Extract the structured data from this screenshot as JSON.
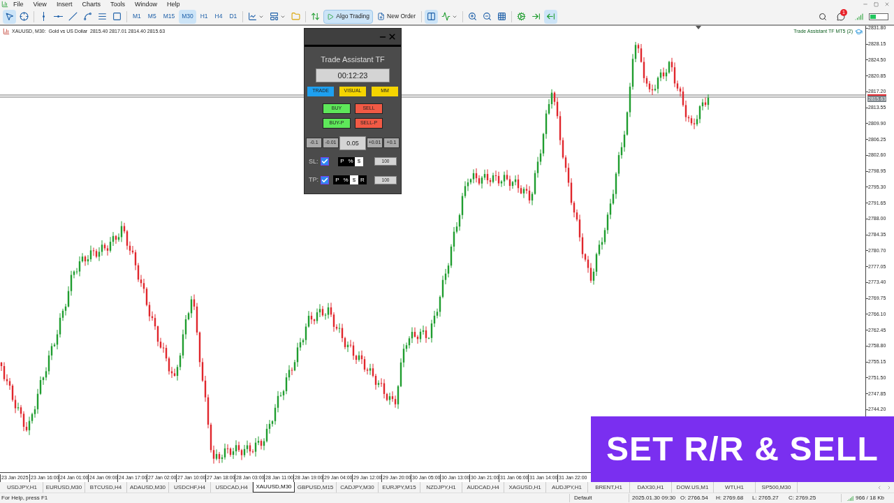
{
  "menu": [
    "File",
    "View",
    "Insert",
    "Charts",
    "Tools",
    "Window",
    "Help"
  ],
  "toolbar": {
    "timeframes": [
      {
        "label": "M1",
        "selected": false
      },
      {
        "label": "M5",
        "selected": false
      },
      {
        "label": "M15",
        "selected": false
      },
      {
        "label": "M30",
        "selected": true
      },
      {
        "label": "H1",
        "selected": false
      },
      {
        "label": "H4",
        "selected": false
      },
      {
        "label": "D1",
        "selected": false
      }
    ],
    "algo_trading": {
      "label": "Algo Trading",
      "selected": true
    },
    "new_order": "New Order",
    "notifications": "1"
  },
  "chart": {
    "header": "XAUUSD, M30:  Gold vs US Dollar  2815.40 2817.01 2814.40 2815.63",
    "indicator_label": "Trade Assistant TF MT5 (2)",
    "price_scale": [
      "2831.80",
      "2828.15",
      "2824.50",
      "2820.85",
      "2817.20",
      "2813.55",
      "2809.90",
      "2806.25",
      "2802.60",
      "2798.95",
      "2795.30",
      "2791.65",
      "2788.00",
      "2784.35",
      "2780.70",
      "2777.05",
      "2773.40",
      "2769.75",
      "2766.10",
      "2762.45",
      "2758.80",
      "2755.15",
      "2751.50",
      "2747.85",
      "2744.20"
    ],
    "current_price": "2815.63",
    "time_scale": [
      "23 Jan 2025",
      "23 Jan 16:00",
      "24 Jan 01:00",
      "24 Jan 09:00",
      "24 Jan 17:00",
      "27 Jan 02:00",
      "27 Jan 10:00",
      "27 Jan 18:00",
      "28 Jan 03:00",
      "28 Jan 11:00",
      "28 Jan 19:00",
      "29 Jan 04:00",
      "29 Jan 12:00",
      "29 Jan 20:00",
      "30 Jan 05:00",
      "30 Jan 13:00",
      "30 Jan 21:00",
      "31 Jan 06:00",
      "31 Jan 14:00",
      "31 Jan 22:00"
    ]
  },
  "panel": {
    "title": "Trade Assistant TF",
    "timer": "00:12:23",
    "tabs": [
      {
        "label": "TRADE",
        "selected": true
      },
      {
        "label": "VISUAL",
        "selected": false
      },
      {
        "label": "MM",
        "selected": false
      }
    ],
    "orders": [
      {
        "label": "BUY",
        "kind": "buy"
      },
      {
        "label": "SELL",
        "kind": "sell"
      },
      {
        "label": "BUY-P",
        "kind": "buy"
      },
      {
        "label": "SELL-P",
        "kind": "sell"
      }
    ],
    "lot_minus": [
      "-0.1",
      "-0.01"
    ],
    "lot": "0.05",
    "lot_plus": [
      "+0.01",
      "+0.1"
    ],
    "levels": [
      {
        "label": "SL:",
        "checked": true,
        "modes": [
          {
            "label": "P",
            "selected": false
          },
          {
            "label": "%",
            "selected": false
          },
          {
            "label": "$",
            "selected": true
          }
        ],
        "value": "100"
      },
      {
        "label": "TP:",
        "checked": true,
        "modes": [
          {
            "label": "P",
            "selected": false
          },
          {
            "label": "%",
            "selected": false
          },
          {
            "label": "$",
            "selected": true
          },
          {
            "label": "R",
            "selected": false
          }
        ],
        "value": "100"
      }
    ]
  },
  "caption": "SET R/R & SELL",
  "symbol_tabs": [
    {
      "label": "USDJPY,H1",
      "selected": false
    },
    {
      "label": "EURUSD,M30",
      "selected": false
    },
    {
      "label": "BTCUSD,H4",
      "selected": false
    },
    {
      "label": "ADAUSD,M30",
      "selected": false
    },
    {
      "label": "USDCHF,H4",
      "selected": false
    },
    {
      "label": "USDCAD,H4",
      "selected": false
    },
    {
      "label": "XAUUSD,M30",
      "selected": true
    },
    {
      "label": "GBPUSD,M15",
      "selected": false
    },
    {
      "label": "CADJPY,M30",
      "selected": false
    },
    {
      "label": "EURJPY,M15",
      "selected": false
    },
    {
      "label": "NZDJPY,H1",
      "selected": false
    },
    {
      "label": "AUDCAD,H4",
      "selected": false
    },
    {
      "label": "XAGUSD,H1",
      "selected": false
    },
    {
      "label": "AUDJPY,H1",
      "selected": false
    },
    {
      "label": "BRENT,H1",
      "selected": false
    },
    {
      "label": "DAX30,H1",
      "selected": false
    },
    {
      "label": "DOW.US,M1",
      "selected": false
    },
    {
      "label": "WTI,H1",
      "selected": false
    },
    {
      "label": "SP500,M30",
      "selected": false
    }
  ],
  "status_bar": {
    "help": "For Help, press F1",
    "profile": "Default",
    "time": "2025.01.30 09:30",
    "open": "O: 2766.54",
    "high": "H: 2769.68",
    "low": "L: 2765.27",
    "close": "C: 2769.25",
    "traffic": "966 / 18 Kb"
  }
}
